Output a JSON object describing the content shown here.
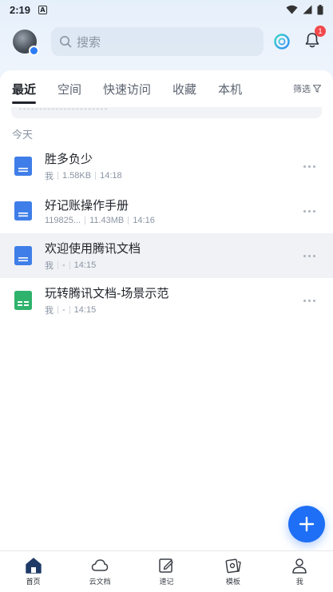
{
  "status_bar": {
    "time": "2:19",
    "notif_letter": "A"
  },
  "header": {
    "search_placeholder": "搜索",
    "notification_count": "1",
    "colors": {
      "accent": "#1e6ff5",
      "badge": "#f2484b"
    }
  },
  "tabs": [
    {
      "label": "最近",
      "active": true
    },
    {
      "label": "空间",
      "active": false
    },
    {
      "label": "快速访问",
      "active": false
    },
    {
      "label": "收藏",
      "active": false
    },
    {
      "label": "本机",
      "active": false
    }
  ],
  "filter_label": "筛选",
  "section_label": "今天",
  "files": [
    {
      "name": "胜多负少",
      "owner": "我",
      "size": "1.58KB",
      "time": "14:18",
      "icon": "doc-icon",
      "color": "#3f7ee8"
    },
    {
      "name": "好记账操作手册",
      "owner": "119825...",
      "size": "11.43MB",
      "time": "14:16",
      "icon": "doc-icon",
      "color": "#3f7ee8"
    },
    {
      "name": "欢迎使用腾讯文档",
      "owner": "我",
      "size": "-",
      "time": "14:15",
      "icon": "doc-icon",
      "color": "#3f7ee8"
    },
    {
      "name": "玩转腾讯文档-场景示范",
      "owner": "我",
      "size": "-",
      "time": "14:15",
      "icon": "sheet-icon",
      "color": "#2fb36c"
    }
  ],
  "bottom_nav": [
    {
      "label": "首页",
      "icon": "home-icon"
    },
    {
      "label": "云文档",
      "icon": "cloud-icon"
    },
    {
      "label": "速记",
      "icon": "note-icon"
    },
    {
      "label": "模板",
      "icon": "template-icon"
    },
    {
      "label": "我",
      "icon": "profile-icon"
    }
  ]
}
